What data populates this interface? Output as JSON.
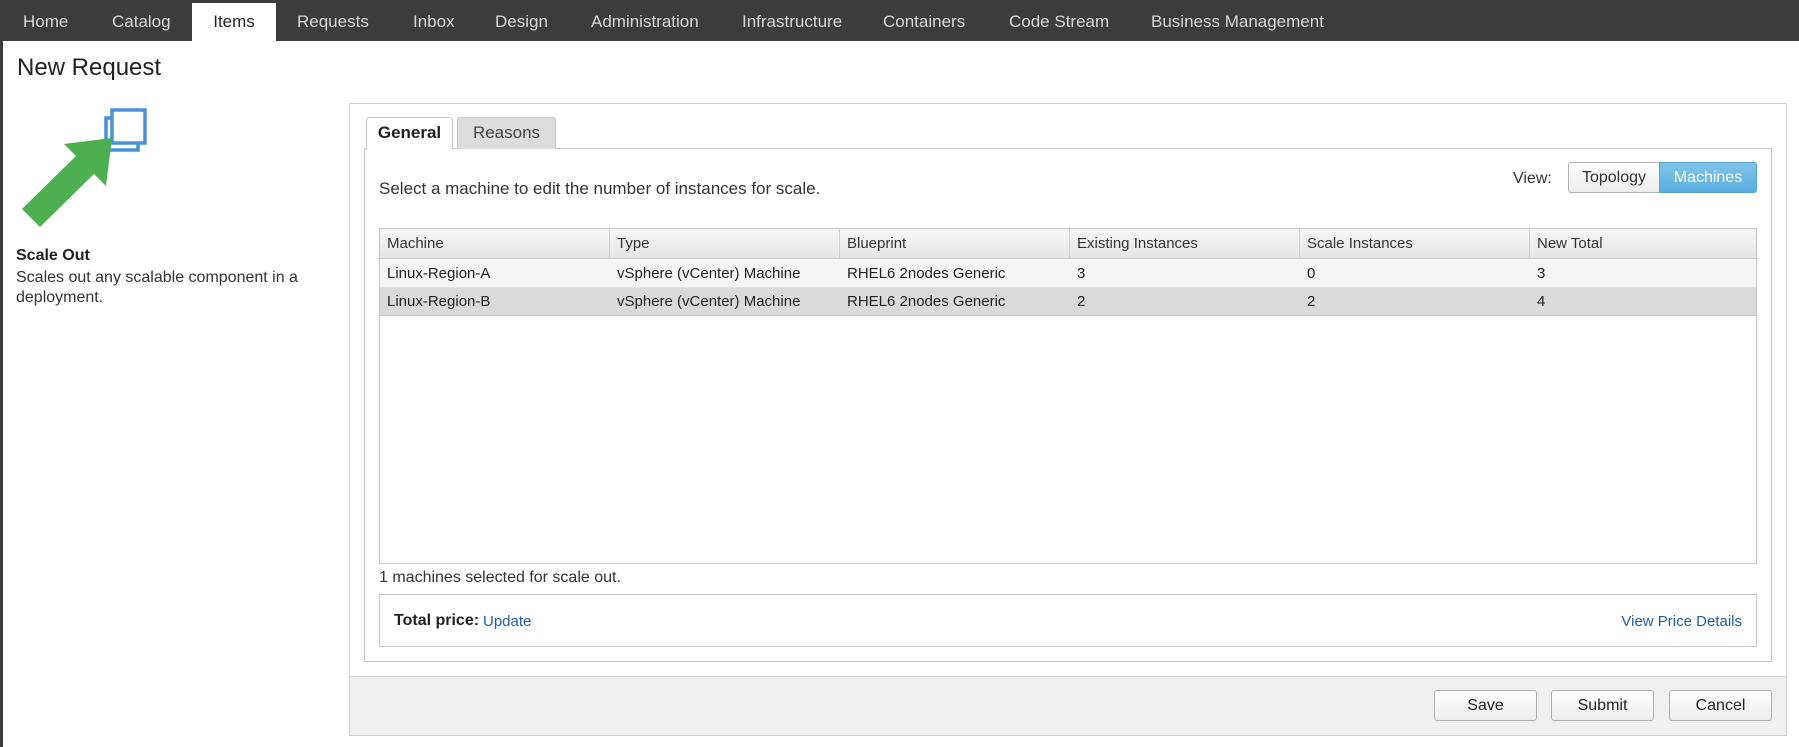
{
  "nav": {
    "tabs": [
      {
        "label": "Home"
      },
      {
        "label": "Catalog"
      },
      {
        "label": "Items",
        "active": true
      },
      {
        "label": "Requests"
      },
      {
        "label": "Inbox"
      },
      {
        "label": "Design"
      },
      {
        "label": "Administration"
      },
      {
        "label": "Infrastructure"
      },
      {
        "label": "Containers"
      },
      {
        "label": "Code Stream"
      },
      {
        "label": "Business Management"
      }
    ]
  },
  "page": {
    "title": "New Request"
  },
  "action": {
    "icon": "scale-out-icon",
    "name": "Scale Out",
    "description": "Scales out any scalable component in a deployment."
  },
  "tabs": {
    "general": "General",
    "reasons": "Reasons"
  },
  "general": {
    "instructions": "Select a machine to edit the number of instances for scale.",
    "view_label": "View:",
    "view_options": [
      "Topology",
      "Machines"
    ],
    "view_selected": "Machines"
  },
  "table": {
    "columns": [
      "Machine",
      "Type",
      "Blueprint",
      "Existing Instances",
      "Scale Instances",
      "New Total"
    ],
    "rows": [
      [
        "Linux-Region-A",
        "vSphere (vCenter) Machine",
        "RHEL6 2nodes Generic",
        "3",
        "0",
        "3"
      ],
      [
        "Linux-Region-B",
        "vSphere (vCenter) Machine",
        "RHEL6 2nodes Generic",
        "2",
        "2",
        "4"
      ]
    ],
    "selected_row": 1
  },
  "summary": {
    "selected_count": "1 machines selected for scale out."
  },
  "price": {
    "label": "Total price:",
    "update_link": "Update",
    "details_link": "View Price Details"
  },
  "buttons": {
    "save": "Save",
    "submit": "Submit",
    "cancel": "Cancel"
  },
  "colors": {
    "nav_bg": "#3c3c3c",
    "accent": "#5aafdf",
    "link": "#1f5da8",
    "icon_blue": "#4a90d9",
    "arrow_green": "#4caf50"
  }
}
